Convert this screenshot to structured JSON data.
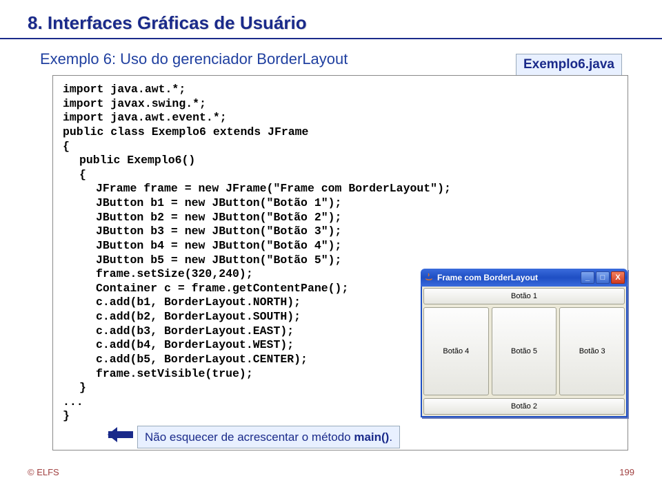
{
  "heading": "8. Interfaces Gráficas de Usuário",
  "subtitle": "Exemplo 6: Uso do gerenciador BorderLayout",
  "file_tag": "Exemplo6.java",
  "code": {
    "l01": "import java.awt.*;",
    "l02": "import javax.swing.*;",
    "l03": "import java.awt.event.*;",
    "l04": "",
    "l05": "public class Exemplo6 extends JFrame",
    "l06": "{",
    "l07": "public Exemplo6()",
    "l08": "{",
    "l09": "JFrame frame = new JFrame(\"Frame com BorderLayout\");",
    "l10": "JButton b1 = new JButton(\"Botão 1\");",
    "l11": "JButton b2 = new JButton(\"Botão 2\");",
    "l12": "JButton b3 = new JButton(\"Botão 3\");",
    "l13": "JButton b4 = new JButton(\"Botão 4\");",
    "l14": "JButton b5 = new JButton(\"Botão 5\");",
    "l15": "frame.setSize(320,240);",
    "l16": "Container c = frame.getContentPane();",
    "l17": "c.add(b1, BorderLayout.NORTH);",
    "l18": "c.add(b2, BorderLayout.SOUTH);",
    "l19": "c.add(b3, BorderLayout.EAST);",
    "l20": "c.add(b4, BorderLayout.WEST);",
    "l21": "c.add(b5, BorderLayout.CENTER);",
    "l22": "frame.setVisible(true);",
    "l23": "}",
    "l24": "...",
    "l25": "}"
  },
  "note_pre": "Não esquecer de acrescentar o método ",
  "note_bold": "main()",
  "note_post": ".",
  "window": {
    "title": "Frame com BorderLayout",
    "btn_min": "_",
    "btn_max": "□",
    "btn_close": "X",
    "b1": "Botão 1",
    "b2": "Botão 2",
    "b3": "Botão 3",
    "b4": "Botão 4",
    "b5": "Botão 5"
  },
  "footer": {
    "left": "© ELFS",
    "right": "199"
  }
}
